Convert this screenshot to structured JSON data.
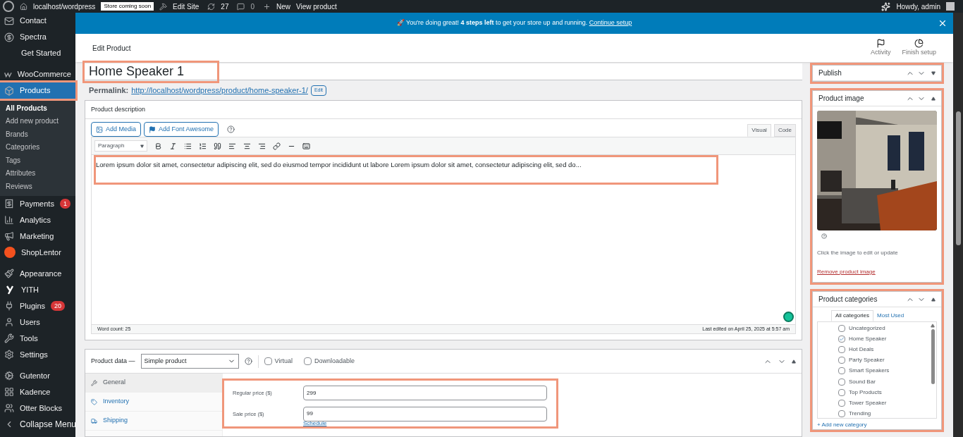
{
  "admin_bar": {
    "site": "localhost/wordpress",
    "badge": "Store coming soon",
    "edit_site": "Edit Site",
    "updates": "27",
    "comments": "0",
    "new": "New",
    "view": "View product",
    "howdy": "Howdy, admin"
  },
  "sidebar": {
    "items": [
      {
        "label": "Contact",
        "selected": false,
        "highlighted": false
      },
      {
        "label": "Spectra",
        "selected": false,
        "highlighted": false
      },
      {
        "label": "Get Started",
        "selected": false,
        "highlighted": false,
        "kind": "sub"
      },
      {
        "label": "WooCommerce",
        "selected": false,
        "highlighted": false,
        "gap": true
      },
      {
        "label": "Products",
        "selected": true,
        "highlighted": true,
        "children": [
          {
            "label": "All Products",
            "selected": true
          },
          {
            "label": "Add new product",
            "selected": false
          },
          {
            "label": "Brands",
            "selected": false
          },
          {
            "label": "Categories",
            "selected": false
          },
          {
            "label": "Tags",
            "selected": false
          },
          {
            "label": "Attributes",
            "selected": false
          },
          {
            "label": "Reviews",
            "selected": false
          }
        ]
      },
      {
        "label": "Payments",
        "selected": false,
        "highlighted": false,
        "badge": "1"
      },
      {
        "label": "Analytics",
        "selected": false,
        "highlighted": false
      },
      {
        "label": "Marketing",
        "selected": false,
        "highlighted": false
      },
      {
        "label": "ShopLentor",
        "selected": false,
        "highlighted": false
      },
      {
        "label": "Appearance",
        "selected": false,
        "highlighted": false,
        "gap": true
      },
      {
        "label": "YITH",
        "selected": false,
        "highlighted": false
      },
      {
        "label": "Plugins",
        "selected": false,
        "highlighted": false,
        "badge": "20"
      },
      {
        "label": "Users",
        "selected": false,
        "highlighted": false
      },
      {
        "label": "Tools",
        "selected": false,
        "highlighted": false
      },
      {
        "label": "Settings",
        "selected": false,
        "highlighted": false
      },
      {
        "label": "Gutentor",
        "selected": false,
        "highlighted": false,
        "gap": true
      },
      {
        "label": "Kadence",
        "selected": false,
        "highlighted": false
      },
      {
        "label": "Otter Blocks",
        "selected": false,
        "highlighted": false
      },
      {
        "label": "Collapse Menu",
        "selected": false,
        "highlighted": false,
        "kind": "collapse"
      }
    ]
  },
  "notice": {
    "text": "🚀 You're doing great! **4 steps left** to get your store up and running.",
    "link": "Continue setup"
  },
  "header": {
    "title": "Edit Product",
    "actions": [
      "Activity",
      "Finish setup"
    ]
  },
  "title_field": {
    "value": "Home Speaker 1",
    "highlighted": true
  },
  "permalink": {
    "label": "Permalink:",
    "url": "http://localhost/wordpress/product/home-speaker-1/",
    "edit": "Edit"
  },
  "description": {
    "title": "Product description",
    "buttons": [
      "Add Media",
      "Add Font Awesome"
    ],
    "tabs": [
      {
        "label": "Visual",
        "selected": true
      },
      {
        "label": "Code",
        "selected": false
      }
    ],
    "format": "Paragraph",
    "text": "Lorem ipsum dolor sit amet, consectetur adipiscing elit, sed do eiusmod tempor incididunt ut labore Lorem ipsum dolor sit amet, consectetur adipiscing elit, sed do...",
    "highlighted": true,
    "word_count": "Word count: 25",
    "last_edited": "Last edited on April 25, 2025 at 5:57 am"
  },
  "product_data": {
    "label": "Product data —",
    "type": "Simple product",
    "options": [
      {
        "label": "Virtual",
        "checked": false
      },
      {
        "label": "Downloadable",
        "checked": false
      }
    ],
    "tabs": [
      {
        "label": "General",
        "selected": true
      },
      {
        "label": "Inventory",
        "selected": false
      },
      {
        "label": "Shipping",
        "selected": false
      }
    ],
    "fields": [
      {
        "label": "Regular price ($)",
        "value": "299"
      },
      {
        "label": "Sale price ($)",
        "value": "99"
      }
    ],
    "schedule": "Schedule",
    "highlighted": true
  },
  "publish": {
    "title": "Publish",
    "highlighted": true
  },
  "product_image": {
    "title": "Product image",
    "hint": "Click the image to edit or update",
    "remove": "Remove product image",
    "highlighted": true
  },
  "categories": {
    "title": "Product categories",
    "highlighted": true,
    "tabs": [
      {
        "label": "All categories",
        "selected": true
      },
      {
        "label": "Most Used",
        "selected": false
      }
    ],
    "items": [
      {
        "label": "Uncategorized",
        "checked": false
      },
      {
        "label": "Home Speaker",
        "checked": true
      },
      {
        "label": "Hot Deals",
        "checked": false
      },
      {
        "label": "Party Speaker",
        "checked": false
      },
      {
        "label": "Smart Speakers",
        "checked": false
      },
      {
        "label": "Sound Bar",
        "checked": false
      },
      {
        "label": "Top Products",
        "checked": false
      },
      {
        "label": "Tower Speaker",
        "checked": false
      },
      {
        "label": "Trending",
        "checked": false
      }
    ],
    "add": "+ Add new category"
  }
}
